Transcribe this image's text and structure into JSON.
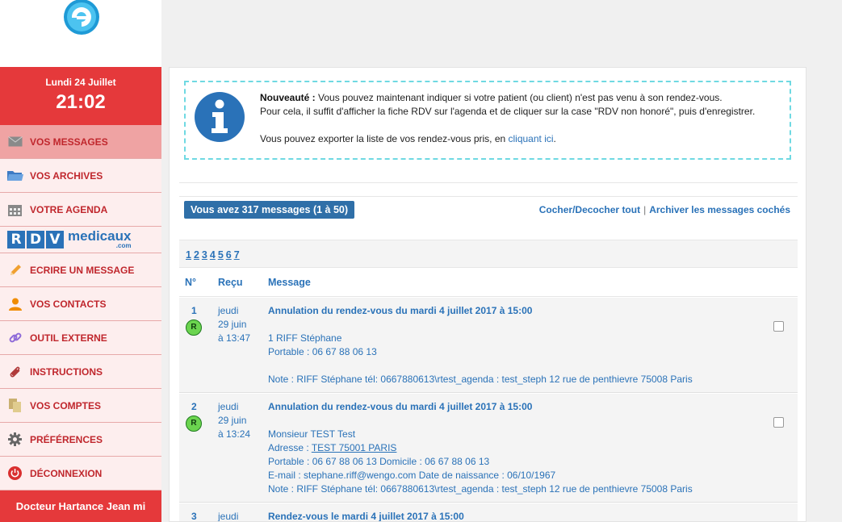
{
  "sidebar": {
    "date": "Lundi 24 Juillet",
    "time": "21:02",
    "items": [
      {
        "label": "VOS MESSAGES",
        "icon": "envelope-icon"
      },
      {
        "label": "VOS ARCHIVES",
        "icon": "folder-icon"
      },
      {
        "label": "VOTRE AGENDA",
        "icon": "calendar-icon"
      },
      {
        "label": "ECRIRE UN MESSAGE",
        "icon": "pencil-icon"
      },
      {
        "label": "VOS CONTACTS",
        "icon": "user-icon"
      },
      {
        "label": "OUTIL EXTERNE",
        "icon": "link-icon"
      },
      {
        "label": "INSTRUCTIONS",
        "icon": "paperclip-icon"
      },
      {
        "label": "VOS COMPTES",
        "icon": "documents-icon"
      },
      {
        "label": "PRÉFÉRENCES",
        "icon": "gear-icon"
      },
      {
        "label": "DÉCONNEXION",
        "icon": "power-icon"
      }
    ],
    "rdv_logo": {
      "letters": [
        "R",
        "D",
        "V"
      ],
      "word": "medicaux",
      "suffix": ".com"
    },
    "user": "Docteur Hartance Jean mi"
  },
  "info": {
    "bold": "Nouveauté :",
    "line1": " Vous pouvez maintenant indiquer si votre patient (ou client) n'est pas venu à son rendez-vous.",
    "line2": "Pour cela, il suffit d'afficher la fiche RDV sur l'agenda et de cliquer sur la case \"RDV non honoré\", puis d'enregistrer.",
    "line3_pre": "Vous pouvez exporter la liste de vos rendez-vous pris, en ",
    "line3_link": "cliquant ici",
    "line3_post": "."
  },
  "messages_header": {
    "count_label": "Vous avez 317 messages (1 à 50)",
    "toggle_all": "Cocher/Decocher tout",
    "separator": "|",
    "archive_checked": "Archiver les messages cochés"
  },
  "pagination": [
    "1",
    "2",
    "3",
    "4",
    "5",
    "6",
    "7"
  ],
  "table": {
    "col_num": "N°",
    "col_received": "Reçu",
    "col_message": "Message"
  },
  "rows": [
    {
      "num": "1",
      "badge": "R",
      "day": "jeudi",
      "date": "29 juin",
      "time": "à 13:47",
      "subject": "Annulation du rendez-vous du mardi 4 juillet 2017 à 15:00",
      "name": "1 RIFF Stéphane",
      "phone": "Portable : 06 67 88 06 13",
      "note": "Note : RIFF Stéphane tél: 0667880613\\rtest_agenda : test_steph 12 rue de penthievre 75008 Paris"
    },
    {
      "num": "2",
      "badge": "R",
      "day": "jeudi",
      "date": "29 juin",
      "time": "à 13:24",
      "subject": "Annulation du rendez-vous du mardi 4 juillet 2017 à 15:00",
      "name": "Monsieur TEST Test",
      "address_label": "Adresse : ",
      "address_link": "TEST 75001 PARIS",
      "phone": "Portable : 06 67 88 06 13 Domicile : 06 67 88 06 13",
      "email": "E-mail : stephane.riff@wengo.com Date de naissance : 06/10/1967",
      "note": "Note : RIFF Stéphane tél: 0667880613\\rtest_agenda : test_steph 12 rue de penthievre 75008 Paris"
    },
    {
      "num": "3",
      "day": "jeudi",
      "subject": "Rendez-vous le mardi 4 juillet 2017 à 15:00"
    }
  ],
  "colors": {
    "brand_red": "#e5393b",
    "sidebar_bg": "#fdeeee",
    "link_blue": "#2a72b8",
    "badge_blue": "#2f6fa8",
    "info_border": "#6fd9e2"
  }
}
